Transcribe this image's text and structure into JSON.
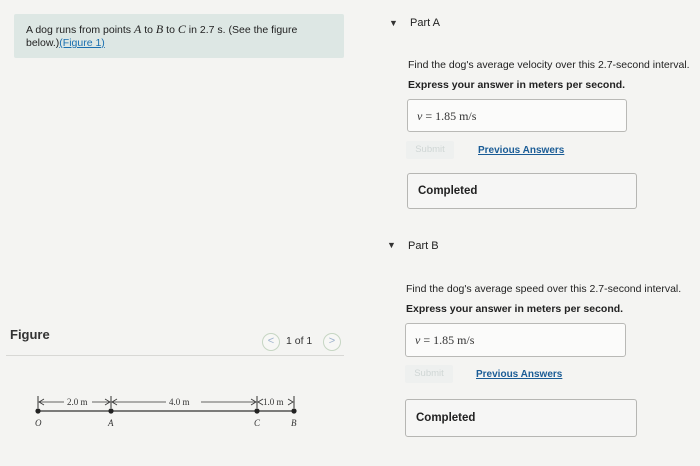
{
  "problem": {
    "text_prefix": "A dog runs from points ",
    "point_a": "A",
    "to1": " to ",
    "point_b": "B",
    "to2": " to ",
    "point_c": "C",
    "text_suffix": " in 2.7 s. (See the figure below.)",
    "figure_link": "(Figure 1)"
  },
  "figure": {
    "label": "Figure",
    "page": "1 of 1",
    "prev_icon": "<",
    "next_icon": ">",
    "dim_oa": "2.0 m",
    "dim_ac": "4.0 m",
    "dim_cb": "1.0 m",
    "point_o": "O",
    "point_a": "A",
    "point_c": "C",
    "point_b": "B"
  },
  "partA": {
    "chevron": "▼",
    "title": "Part A",
    "question": "Find the dog's average velocity over this 2.7-second interval.",
    "instruction": "Express your answer in meters per second.",
    "answer_var": "v",
    "answer_eq": " =  1.85  m/s",
    "submit_label": "Submit",
    "previous_answers": "Previous Answers",
    "completed": "Completed"
  },
  "partB": {
    "chevron": "▼",
    "title": "Part B",
    "question": "Find the dog's average speed over this 2.7-second interval.",
    "instruction": "Express your answer in meters per second.",
    "answer_var": "v",
    "answer_eq": " =  1.85  m/s",
    "submit_label": "Submit",
    "previous_answers": "Previous Answers",
    "completed": "Completed"
  }
}
